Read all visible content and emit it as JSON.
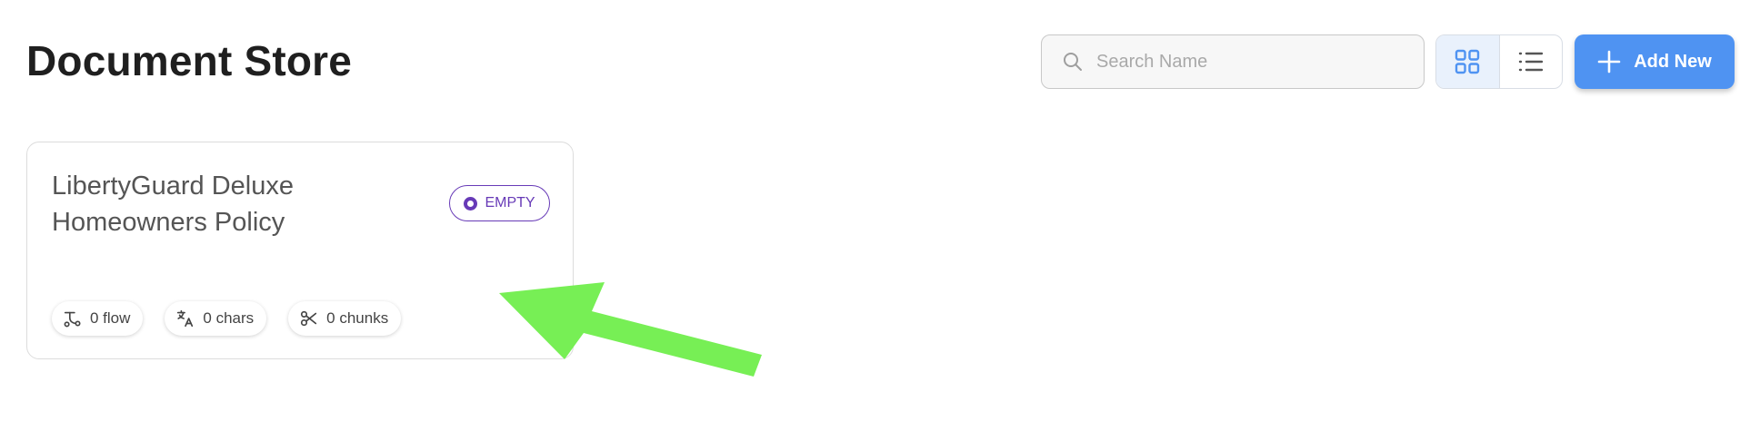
{
  "header": {
    "title": "Document Store",
    "search": {
      "placeholder": "Search Name",
      "value": ""
    },
    "view_toggle": {
      "active": "grid",
      "options": [
        "grid-icon",
        "list-icon"
      ]
    },
    "add_new_label": "Add New"
  },
  "stores": [
    {
      "name": "LibertyGuard Deluxe Homeowners Policy",
      "status": "EMPTY",
      "stats": {
        "flow": "0 flow",
        "chars": "0 chars",
        "chunks": "0 chunks"
      }
    }
  ],
  "colors": {
    "accent": "#4f93f2",
    "status_empty": "#673ab7",
    "annotation_arrow": "#77ef55",
    "toggle_active_bg": "#e9f1fc"
  },
  "icons": {
    "search": "search-icon",
    "grid": "grid-icon",
    "list": "list-icon",
    "add": "plus-icon",
    "flow": "flow-icon",
    "chars": "translate-icon",
    "chunks": "scissors-icon"
  }
}
